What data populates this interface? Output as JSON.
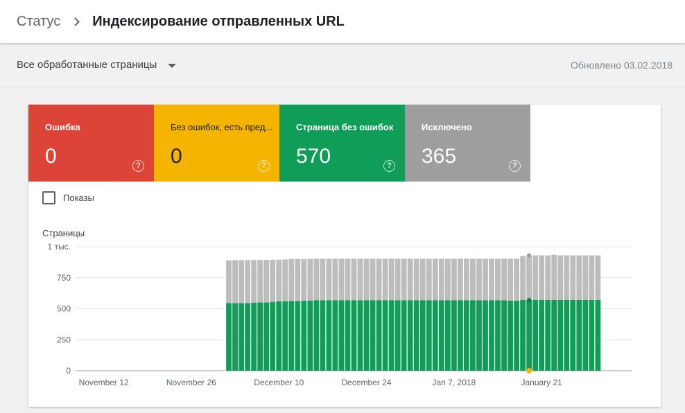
{
  "breadcrumb": {
    "root": "Статус",
    "title": "Индексирование отправленных URL"
  },
  "filter": {
    "selected": "Все обработанные страницы",
    "updated": "Обновлено 03.02.2018"
  },
  "tiles": [
    {
      "label": "Ошибка",
      "value": "0",
      "color": "#db4437"
    },
    {
      "label": "Без ошибок, есть пред...",
      "value": "0",
      "color": "#f4b400"
    },
    {
      "label": "Страница без ошибок",
      "value": "570",
      "color": "#0f9d58"
    },
    {
      "label": "Исключено",
      "value": "365",
      "color": "#9e9e9e"
    }
  ],
  "impressions_toggle": {
    "label": "Показы",
    "checked": false
  },
  "chart_data": {
    "type": "bar",
    "stacked": true,
    "ylabel": "Страницы",
    "ylim": [
      0,
      1000
    ],
    "yticks": [
      {
        "value": 0,
        "label": "0"
      },
      {
        "value": 250,
        "label": "250"
      },
      {
        "value": 500,
        "label": "500"
      },
      {
        "value": 750,
        "label": "750"
      },
      {
        "value": 1000,
        "label": "1 тыс."
      }
    ],
    "xticks": [
      {
        "label": "November 12",
        "index": 4
      },
      {
        "label": "November 26",
        "index": 18
      },
      {
        "label": "December 10",
        "index": 32
      },
      {
        "label": "December 24",
        "index": 46
      },
      {
        "label": "Jan 7, 2018",
        "index": 60
      },
      {
        "label": "January 21",
        "index": 74
      }
    ],
    "slot_count": 89,
    "first_bar_index": 24,
    "series": [
      {
        "name": "Страница без ошибок",
        "color": "#0f9d58",
        "values": [
          545,
          545,
          545,
          545,
          548,
          550,
          550,
          555,
          560,
          560,
          562,
          562,
          565,
          565,
          568,
          568,
          568,
          568,
          568,
          568,
          568,
          568,
          568,
          568,
          568,
          568,
          568,
          568,
          568,
          568,
          568,
          568,
          568,
          568,
          568,
          568,
          568,
          568,
          568,
          568,
          568,
          568,
          568,
          568,
          568,
          565,
          565,
          570,
          570,
          570,
          570,
          570,
          570,
          570,
          570,
          570,
          570,
          570,
          570,
          570
        ]
      },
      {
        "name": "Исключено",
        "color": "#bdbdbd",
        "values": [
          345,
          347,
          347,
          347,
          345,
          344,
          344,
          340,
          335,
          337,
          338,
          340,
          335,
          337,
          335,
          335,
          335,
          335,
          335,
          335,
          335,
          335,
          335,
          335,
          335,
          335,
          335,
          335,
          335,
          335,
          335,
          335,
          335,
          335,
          335,
          335,
          335,
          335,
          335,
          335,
          335,
          335,
          335,
          335,
          335,
          338,
          338,
          355,
          360,
          360,
          360,
          360,
          365,
          360,
          360,
          360,
          360,
          360,
          360,
          360
        ]
      }
    ],
    "grid": true,
    "annotation": {
      "index": 72,
      "color": "#f4b400"
    }
  }
}
